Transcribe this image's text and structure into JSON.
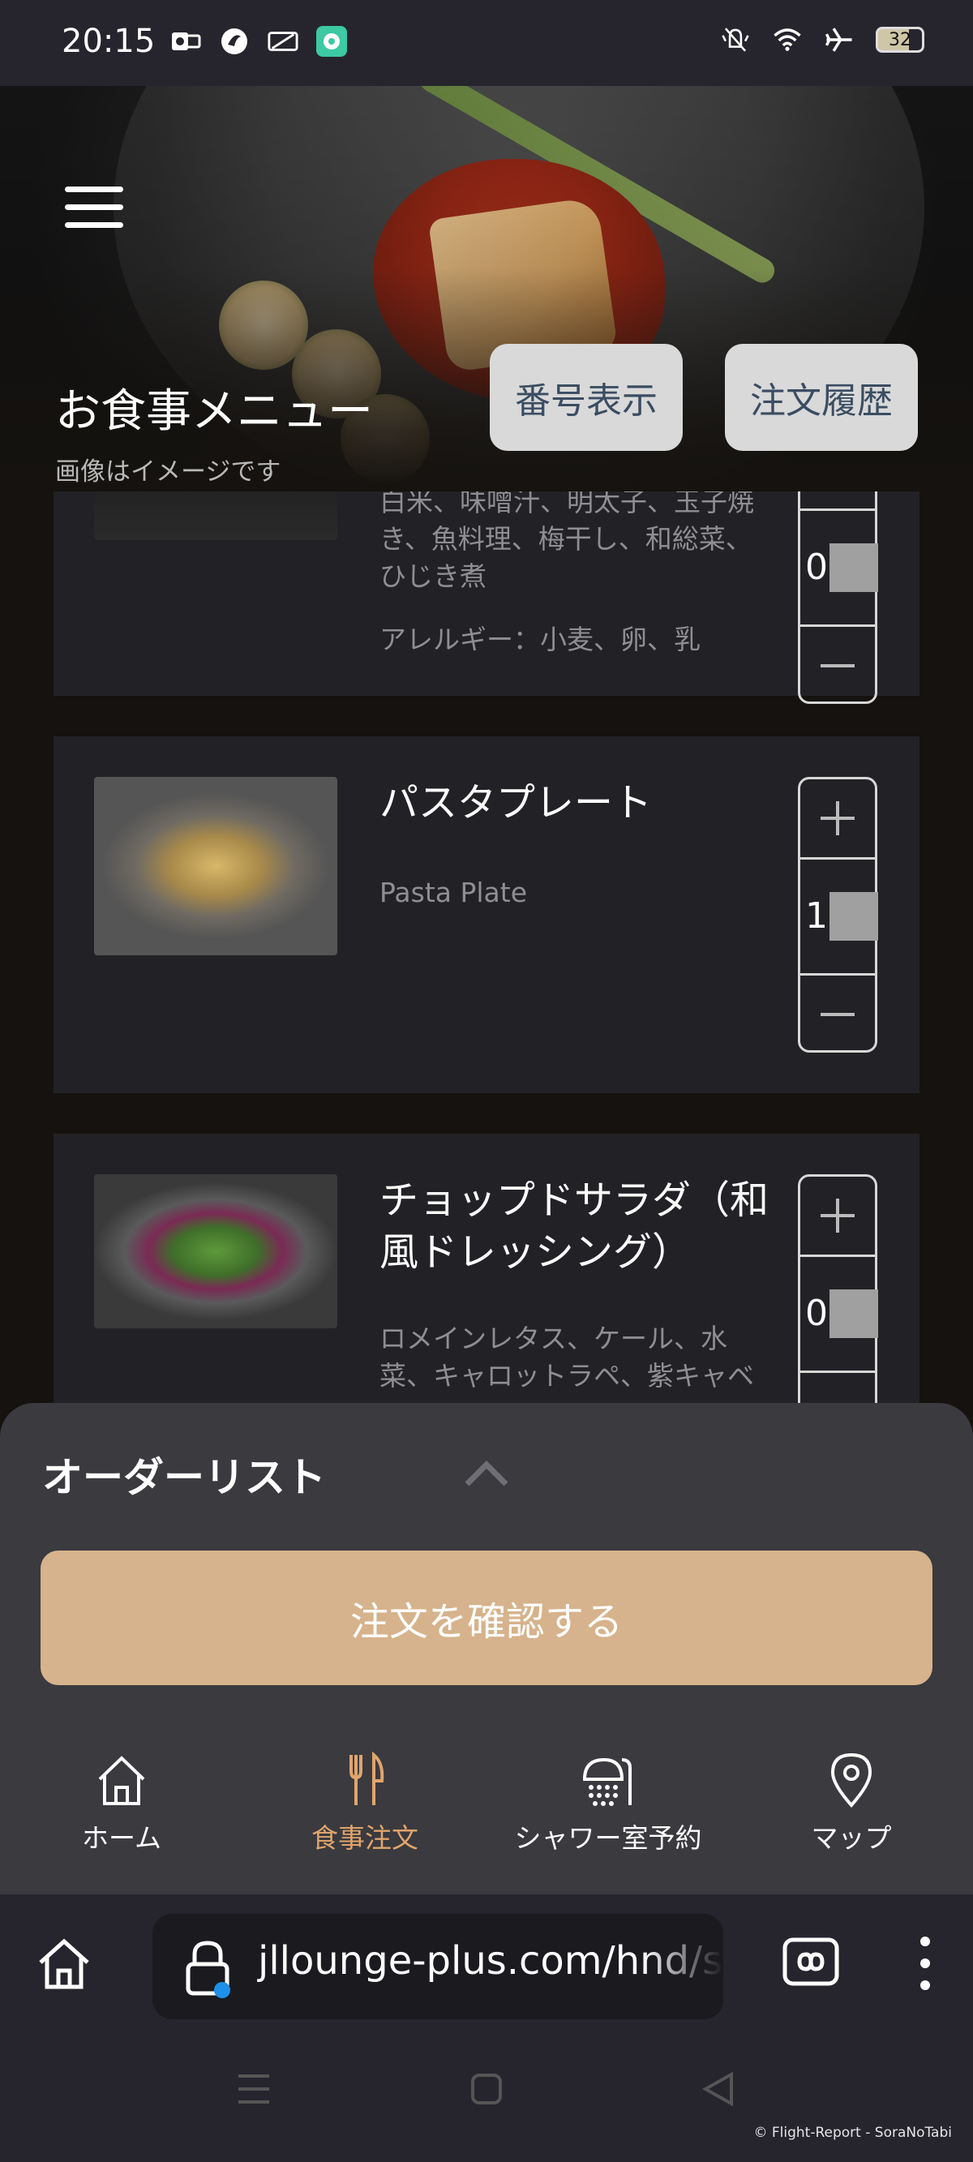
{
  "status_bar": {
    "time": "20:15",
    "battery": "32",
    "left_icons": [
      "outlook-icon",
      "jal-icon",
      "card-icon",
      "chat-app-icon"
    ],
    "right_icons": [
      "mute-icon",
      "wifi-icon",
      "airplane-icon",
      "battery-icon"
    ]
  },
  "header": {
    "title": "お食事メニュー",
    "subtitle": "画像はイメージです",
    "number_button": "番号表示",
    "history_button": "注文履歴"
  },
  "menu_items": [
    {
      "name": "",
      "desc_lines": [
        "白米、味噌汁、明太子、玉子焼",
        "き、魚料理、梅干し、和総菜、",
        "ひじき煮"
      ],
      "allergy": "アレルギー：小麦、卵、乳",
      "qty": "0"
    },
    {
      "name": "パスタプレート",
      "desc_lines": [
        "Pasta Plate"
      ],
      "qty": "1"
    },
    {
      "name": "チョップドサラダ（和風ドレッシング）",
      "desc_lines": [
        "ロメインレタス、ケール、水",
        "菜、キャロットラペ、紫キャベ"
      ],
      "qty": "0"
    }
  ],
  "order_sheet": {
    "title": "オーダーリスト",
    "confirm_button": "注文を確認する"
  },
  "tabs": [
    {
      "label": "ホーム",
      "icon": "home-icon",
      "active": false
    },
    {
      "label": "食事注文",
      "icon": "fork-knife-icon",
      "active": true
    },
    {
      "label": "シャワー室予約",
      "icon": "shower-icon",
      "active": false
    },
    {
      "label": "マップ",
      "icon": "map-pin-icon",
      "active": false
    }
  ],
  "browser": {
    "url": "jllounge-plus.com/hnd/sa"
  },
  "watermark": "© Flight-Report - SoraNoTabi",
  "colors": {
    "accent": "#e0a46c",
    "confirm_button": "#d6b38c",
    "sheet": "#3a3a3f",
    "card": "#222226"
  }
}
